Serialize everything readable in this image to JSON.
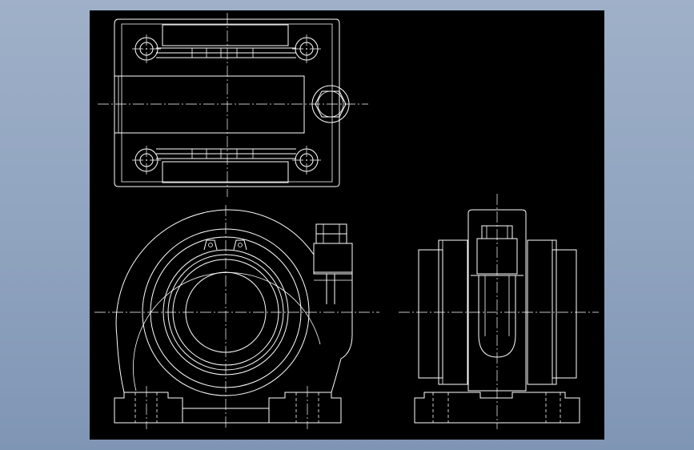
{
  "canvas": {
    "background_color": "#000000",
    "line_color": "#ffffff",
    "frame_color": "#8fa3bf"
  },
  "views": [
    {
      "name": "top-view"
    },
    {
      "name": "front-view"
    },
    {
      "name": "side-view"
    }
  ]
}
